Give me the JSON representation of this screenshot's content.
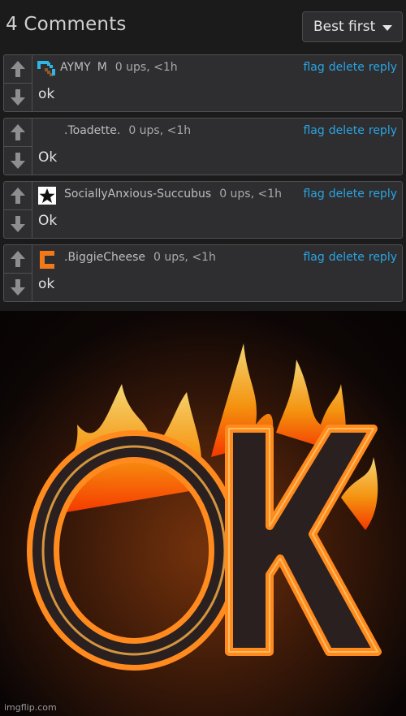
{
  "header": {
    "count_label": "4 Comments",
    "sort_label": "Best first"
  },
  "comments": [
    {
      "user": "AYMY",
      "badge": "M",
      "stats": "0 ups, <1h",
      "text": "ok",
      "avatar": "pixel-pickaxe-icon"
    },
    {
      "user": ".Toadette.",
      "badge": "",
      "stats": "0 ups, <1h",
      "text": "Ok",
      "avatar": ""
    },
    {
      "user": "SociallyAnxious-Succubus",
      "badge": "",
      "stats": "0 ups, <1h",
      "text": "Ok",
      "avatar": "star-icon"
    },
    {
      "user": ".BiggieCheese",
      "badge": "",
      "stats": "0 ups, <1h",
      "text": "ok",
      "avatar": "orange-bracket-icon"
    }
  ],
  "actions": {
    "flag": "flag",
    "delete": "delete",
    "reply": "reply"
  },
  "image": {
    "caption_text": "OK",
    "watermark": "imgflip.com"
  },
  "colors": {
    "link": "#2aa4e2",
    "panel": "#2e2e30",
    "background": "#1b1b1c"
  }
}
